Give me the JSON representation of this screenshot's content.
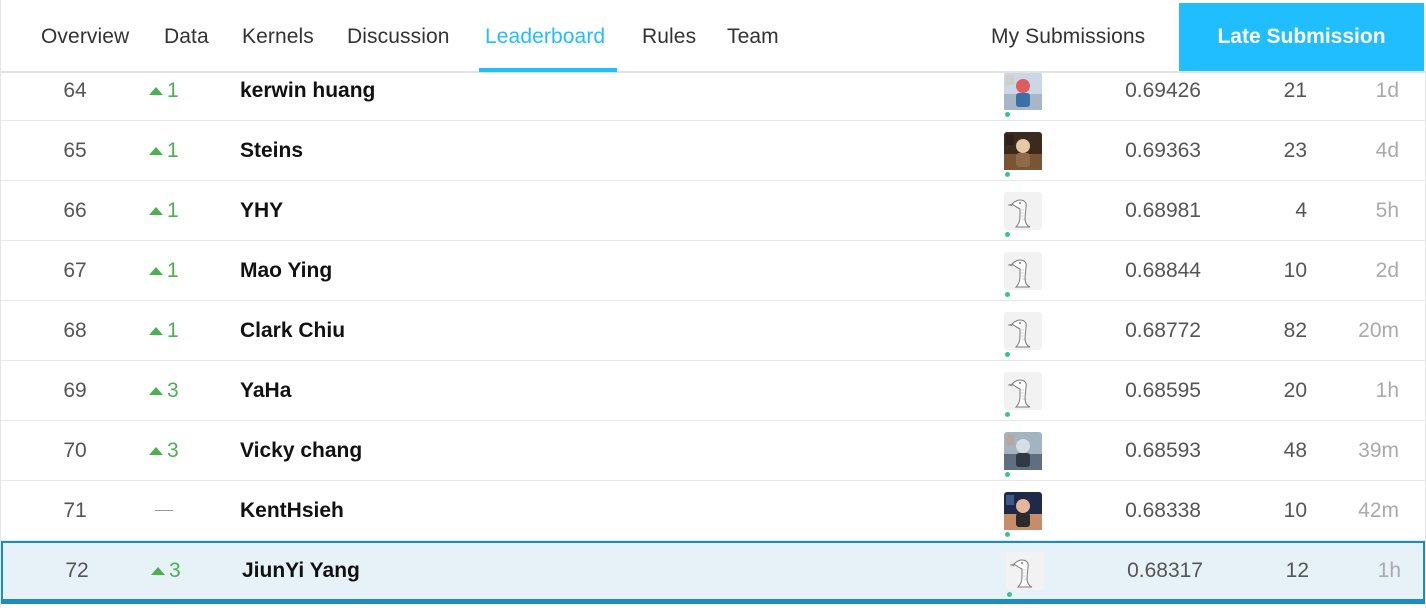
{
  "nav": {
    "tabs": [
      {
        "label": "Overview",
        "active": false
      },
      {
        "label": "Data",
        "active": false
      },
      {
        "label": "Kernels",
        "active": false
      },
      {
        "label": "Discussion",
        "active": false
      },
      {
        "label": "Leaderboard",
        "active": true
      },
      {
        "label": "Rules",
        "active": false
      },
      {
        "label": "Team",
        "active": false
      }
    ],
    "my_submissions": "My Submissions",
    "late_submission": "Late Submission"
  },
  "colors": {
    "accent": "#20beff",
    "up_green": "#4caf50",
    "highlight_bg": "#e6f1f8",
    "highlight_border": "#1d8cbf",
    "status_dot": "#3fbf99"
  },
  "rows": [
    {
      "rank": "64",
      "change": "up",
      "delta": "1",
      "team": "kerwin huang",
      "avatar": "photo-avatar-outdoor",
      "score": "0.69426",
      "entries": "21",
      "last": "1d",
      "highlight": false
    },
    {
      "rank": "65",
      "change": "up",
      "delta": "1",
      "team": "Steins",
      "avatar": "photo-avatar-anime",
      "score": "0.69363",
      "entries": "23",
      "last": "4d",
      "highlight": false
    },
    {
      "rank": "66",
      "change": "up",
      "delta": "1",
      "team": "YHY",
      "avatar": "default-goose-avatar",
      "score": "0.68981",
      "entries": "4",
      "last": "5h",
      "highlight": false
    },
    {
      "rank": "67",
      "change": "up",
      "delta": "1",
      "team": "Mao Ying",
      "avatar": "default-goose-avatar",
      "score": "0.68844",
      "entries": "10",
      "last": "2d",
      "highlight": false
    },
    {
      "rank": "68",
      "change": "up",
      "delta": "1",
      "team": "Clark Chiu",
      "avatar": "default-goose-avatar",
      "score": "0.68772",
      "entries": "82",
      "last": "20m",
      "highlight": false
    },
    {
      "rank": "69",
      "change": "up",
      "delta": "3",
      "team": "YaHa",
      "avatar": "default-goose-avatar",
      "score": "0.68595",
      "entries": "20",
      "last": "1h",
      "highlight": false
    },
    {
      "rank": "70",
      "change": "up",
      "delta": "3",
      "team": "Vicky chang",
      "avatar": "photo-avatar-street",
      "score": "0.68593",
      "entries": "48",
      "last": "39m",
      "highlight": false
    },
    {
      "rank": "71",
      "change": "none",
      "delta": "",
      "team": "KentHsieh",
      "avatar": "photo-avatar-person",
      "score": "0.68338",
      "entries": "10",
      "last": "42m",
      "highlight": false
    },
    {
      "rank": "72",
      "change": "up",
      "delta": "3",
      "team": "JiunYi Yang",
      "avatar": "default-goose-avatar",
      "score": "0.68317",
      "entries": "12",
      "last": "1h",
      "highlight": true
    }
  ]
}
